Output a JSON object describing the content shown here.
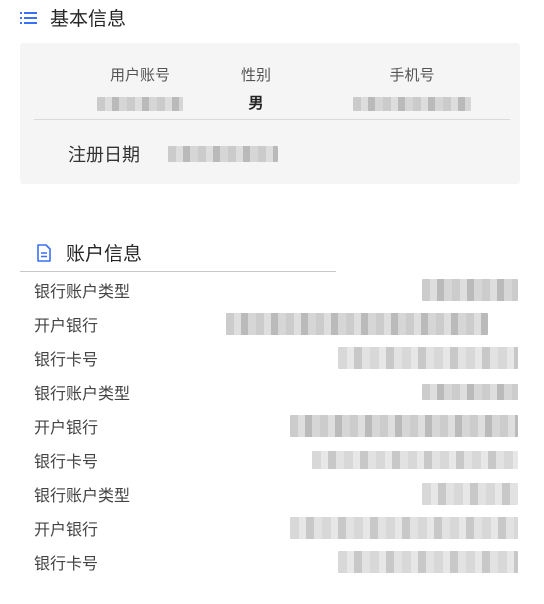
{
  "basic_info": {
    "title": "基本信息",
    "icon": "list-icon",
    "fields": [
      {
        "label": "用户账号",
        "value": ""
      },
      {
        "label": "性别",
        "value": "男"
      },
      {
        "label": "手机号",
        "value": ""
      }
    ],
    "register_date": {
      "label": "注册日期",
      "value": ""
    }
  },
  "account_info": {
    "title": "账户信息",
    "icon": "document-icon",
    "rows": [
      {
        "label": "银行账户类型"
      },
      {
        "label": "开户银行"
      },
      {
        "label": "银行卡号"
      },
      {
        "label": "银行账户类型"
      },
      {
        "label": "开户银行"
      },
      {
        "label": "银行卡号"
      },
      {
        "label": "银行账户类型"
      },
      {
        "label": "开户银行"
      },
      {
        "label": "银行卡号"
      }
    ]
  },
  "colors": {
    "accent": "#3a6ff7",
    "card_bg": "#f5f5f5"
  }
}
